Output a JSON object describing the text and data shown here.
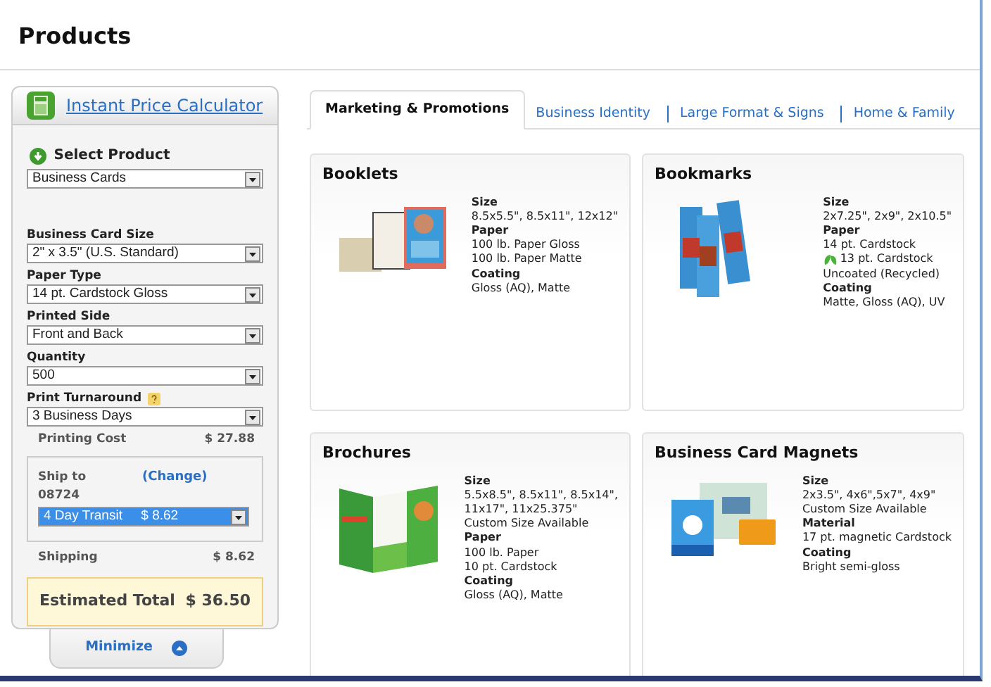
{
  "page_title": "Products",
  "calculator": {
    "title": "Instant Price Calculator",
    "select_label": "Select Product",
    "product": "Business Cards",
    "fields": [
      {
        "label": "Business Card Size",
        "value": "2\" x 3.5\" (U.S. Standard)",
        "help": false
      },
      {
        "label": "Paper Type",
        "value": "14 pt. Cardstock Gloss",
        "help": false
      },
      {
        "label": "Printed Side",
        "value": "Front and Back",
        "help": false
      },
      {
        "label": "Quantity",
        "value": "500",
        "help": false
      },
      {
        "label": "Print Turnaround",
        "value": "3 Business Days",
        "help": true
      }
    ],
    "printing_cost": {
      "label": "Printing Cost",
      "value": "$ 27.88"
    },
    "ship": {
      "label": "Ship to",
      "zip": "08724",
      "change": "(Change)",
      "option": "4 Day Transit     $ 8.62",
      "highlighted": true
    },
    "shipping": {
      "label": "Shipping",
      "value": "$ 8.62"
    },
    "total": {
      "label": "Estimated Total",
      "value": "$ 36.50"
    },
    "minimize": "Minimize"
  },
  "tabs": [
    {
      "label": "Marketing & Promotions",
      "selected": true
    },
    {
      "label": "Business Identity",
      "selected": false
    },
    {
      "label": "Large Format & Signs",
      "selected": false
    },
    {
      "label": "Home & Family",
      "selected": false
    }
  ],
  "products": [
    {
      "name": "Booklets",
      "kind": "picture",
      "lines": [
        {
          "kind": "heading",
          "text": "Size"
        },
        {
          "kind": "value",
          "text": "8.5x5.5\", 8.5x11\", 12x12\""
        },
        {
          "kind": "heading",
          "text": "Paper"
        },
        {
          "kind": "value",
          "text": "100 lb. Paper Gloss"
        },
        {
          "kind": "value",
          "text": "100 lb. Paper Matte"
        },
        {
          "kind": "heading",
          "text": "Coating"
        },
        {
          "kind": "value",
          "text": "Gloss (AQ), Matte"
        }
      ]
    },
    {
      "name": "Bookmarks",
      "kind": "picture",
      "lines": [
        {
          "kind": "heading",
          "text": "Size"
        },
        {
          "kind": "value",
          "text": "2x7.25\", 2x9\", 2x10.5\""
        },
        {
          "kind": "heading",
          "text": "Paper"
        },
        {
          "kind": "value",
          "text": "14 pt. Cardstock"
        },
        {
          "kind": "eco",
          "text": "13 pt. Cardstock"
        },
        {
          "kind": "value",
          "text": "Uncoated (Recycled)"
        },
        {
          "kind": "heading",
          "text": "Coating"
        },
        {
          "kind": "value",
          "text": "Matte, Gloss (AQ), UV"
        }
      ]
    },
    {
      "name": "Brochures",
      "kind": "picture",
      "lines": [
        {
          "kind": "heading",
          "text": "Size"
        },
        {
          "kind": "value",
          "text": "5.5x8.5\", 8.5x11\", 8.5x14\","
        },
        {
          "kind": "value",
          "text": "11x17\", 11x25.375\""
        },
        {
          "kind": "value",
          "text": "Custom Size Available"
        },
        {
          "kind": "heading",
          "text": "Paper"
        },
        {
          "kind": "value",
          "text": "100 lb. Paper"
        },
        {
          "kind": "value",
          "text": "10 pt. Cardstock"
        },
        {
          "kind": "heading",
          "text": "Coating"
        },
        {
          "kind": "value",
          "text": "Gloss (AQ), Matte"
        }
      ]
    },
    {
      "name": "Business Card Magnets",
      "kind": "picture",
      "lines": [
        {
          "kind": "heading",
          "text": "Size"
        },
        {
          "kind": "value",
          "text": "2x3.5\", 4x6\",5x7\", 4x9\""
        },
        {
          "kind": "value",
          "text": "Custom Size Available"
        },
        {
          "kind": "heading",
          "text": "Material"
        },
        {
          "kind": "value",
          "text": "17 pt. magnetic Cardstock"
        },
        {
          "kind": "heading",
          "text": "Coating"
        },
        {
          "kind": "value",
          "text": "Bright semi-gloss"
        }
      ]
    }
  ]
}
